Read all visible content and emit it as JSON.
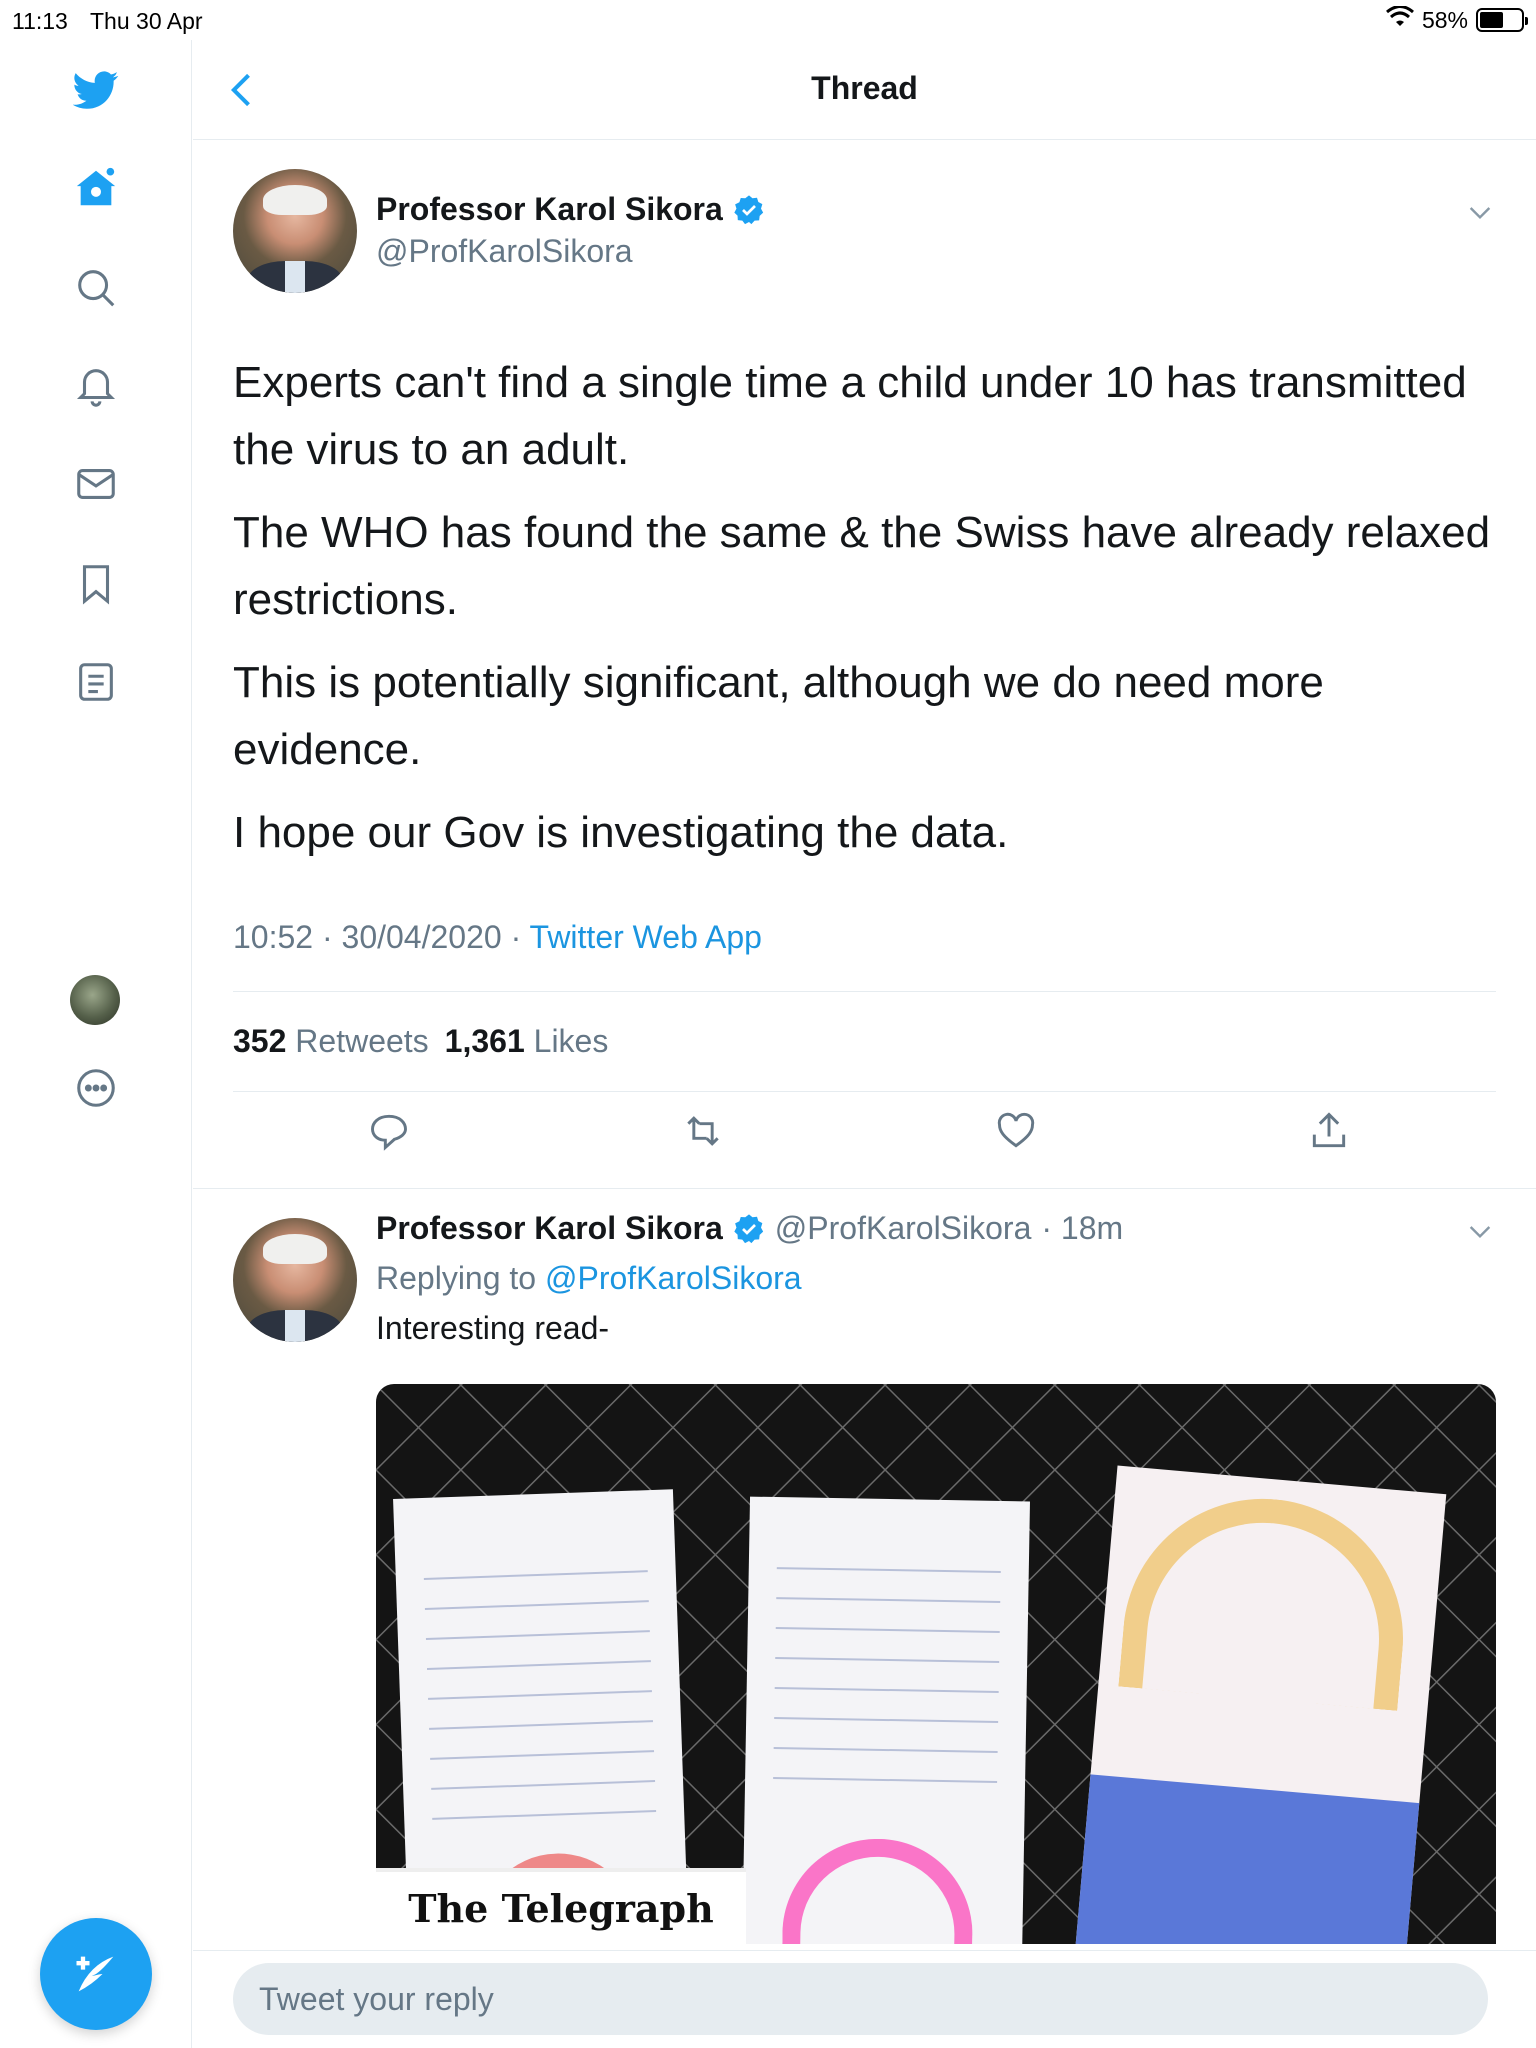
{
  "status_bar": {
    "time": "11:13",
    "date": "Thu 30 Apr",
    "battery": "58%",
    "battery_level": 0.58
  },
  "header": {
    "title": "Thread"
  },
  "main_tweet": {
    "author_name": "Professor Karol Sikora",
    "author_handle": "@ProfKarolSikora",
    "paragraphs": [
      "Experts can't find a single time a child under 10 has transmitted the virus to an adult.",
      "The WHO has found the same & the Swiss have already relaxed restrictions.",
      "This is potentially significant, although we do need more evidence.",
      "I hope our Gov is investigating the data."
    ],
    "timestamp": "10:52 · 30/04/2020 · ",
    "source_app": "Twitter Web App",
    "retweets_count": "352",
    "retweets_label": "Retweets",
    "likes_count": "1,361",
    "likes_label": "Likes"
  },
  "reply_tweet": {
    "author_name": "Professor Karol Sikora",
    "author_handle": "@ProfKarolSikora",
    "time_ago": "· 18m",
    "replying_label": "Replying to",
    "replying_to": "@ProfKarolSikora",
    "text": "Interesting read-",
    "media_caption": "The Telegraph"
  },
  "reply_box": {
    "placeholder": "Tweet your reply"
  },
  "icons": {
    "logo": "twitter-bird-icon",
    "nav": [
      "home-icon",
      "search-icon",
      "bell-icon",
      "mail-icon",
      "bookmark-icon",
      "list-icon",
      "profile-avatar",
      "more-icon"
    ],
    "actions": [
      "reply-icon",
      "retweet-icon",
      "like-icon",
      "share-icon"
    ]
  },
  "colors": {
    "accent": "#1da1f2",
    "link": "#1b95e0",
    "secondary_text": "#657786",
    "border": "#e6ecf0"
  }
}
